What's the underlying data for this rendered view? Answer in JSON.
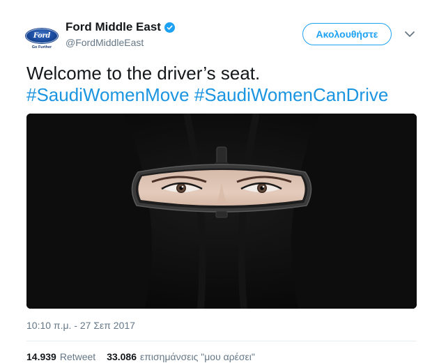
{
  "author": {
    "logo_text": "Ford",
    "logo_tagline": "Go Further",
    "display_name": "Ford Middle East",
    "handle": "@FordMiddleEast",
    "verified": true
  },
  "follow_label": "Ακολουθήστε",
  "tweet": {
    "text": "Welcome to the driver’s seat.",
    "hashtags": [
      "#SaudiWomenMove",
      "#SaudiWomenCanDrive"
    ]
  },
  "timestamp": "10:10 π.μ. - 27 Σεπ 2017",
  "stats": {
    "retweets_count": "14.939",
    "retweets_label": "Retweet",
    "likes_count": "33.086",
    "likes_label": "επισημάνσεις \"μου αρέσει\""
  },
  "colors": {
    "accent": "#1da1f2",
    "hashtag": "#1b95e0",
    "muted": "#657786",
    "text": "#14171a"
  },
  "icons": {
    "verified": "verified-badge-icon",
    "menu": "chevron-down-icon"
  }
}
